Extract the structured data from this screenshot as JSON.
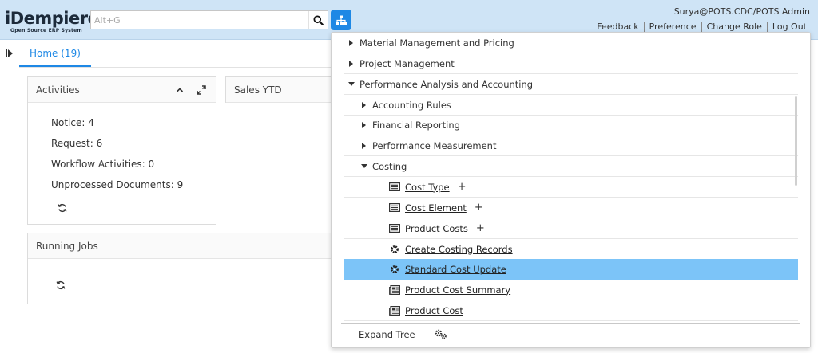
{
  "header": {
    "logo_text": "iDempiere",
    "logo_tagline": "Open Source ERP System",
    "search_placeholder": "Alt+G",
    "user": "Surya@POTS.CDC/POTS Admin",
    "links": [
      "Feedback",
      "Preference",
      "Change Role",
      "Log Out"
    ]
  },
  "tabs": {
    "home": "Home (19)"
  },
  "activities": {
    "title": "Activities",
    "rows": [
      "Notice: 4",
      "Request: 6",
      "Workflow Activities: 0",
      "Unprocessed Documents: 9"
    ]
  },
  "sales": {
    "title": "Sales YTD"
  },
  "jobs": {
    "title": "Running Jobs"
  },
  "menu": {
    "items": [
      {
        "label": "Material Management and Pricing",
        "kind": "folder",
        "expanded": false,
        "level": 0
      },
      {
        "label": "Project Management",
        "kind": "folder",
        "expanded": false,
        "level": 0
      },
      {
        "label": "Performance Analysis and Accounting",
        "kind": "folder",
        "expanded": true,
        "level": 0
      },
      {
        "label": "Accounting Rules",
        "kind": "folder",
        "expanded": false,
        "level": 1
      },
      {
        "label": "Financial Reporting",
        "kind": "folder",
        "expanded": false,
        "level": 1
      },
      {
        "label": "Performance Measurement",
        "kind": "folder",
        "expanded": false,
        "level": 1
      },
      {
        "label": "Costing",
        "kind": "folder",
        "expanded": true,
        "level": 1
      },
      {
        "label": "Cost Type",
        "kind": "window",
        "plus": "+",
        "level": 2
      },
      {
        "label": "Cost Element",
        "kind": "window",
        "plus": "+",
        "level": 2
      },
      {
        "label": "Product Costs",
        "kind": "window",
        "plus": "+",
        "level": 2
      },
      {
        "label": "Create Costing Records",
        "kind": "process",
        "level": 2
      },
      {
        "label": "Standard Cost Update",
        "kind": "process",
        "selected": true,
        "level": 2
      },
      {
        "label": "Product Cost Summary",
        "kind": "report",
        "level": 2
      },
      {
        "label": "Product Cost",
        "kind": "report",
        "level": 2
      }
    ],
    "expand_tree": "Expand Tree"
  },
  "colors": {
    "header_bg": "#cfe4f6",
    "accent": "#1e88e5",
    "selected_row": "#7cc4f8"
  },
  "icons": [
    "search-icon",
    "sitemap-icon",
    "sidebar-toggle-icon",
    "chevron-up-icon",
    "expand-icon",
    "refresh-icon",
    "caret-right-icon",
    "caret-down-icon",
    "window-icon",
    "process-gear-icon",
    "report-icon",
    "gears-icon"
  ]
}
